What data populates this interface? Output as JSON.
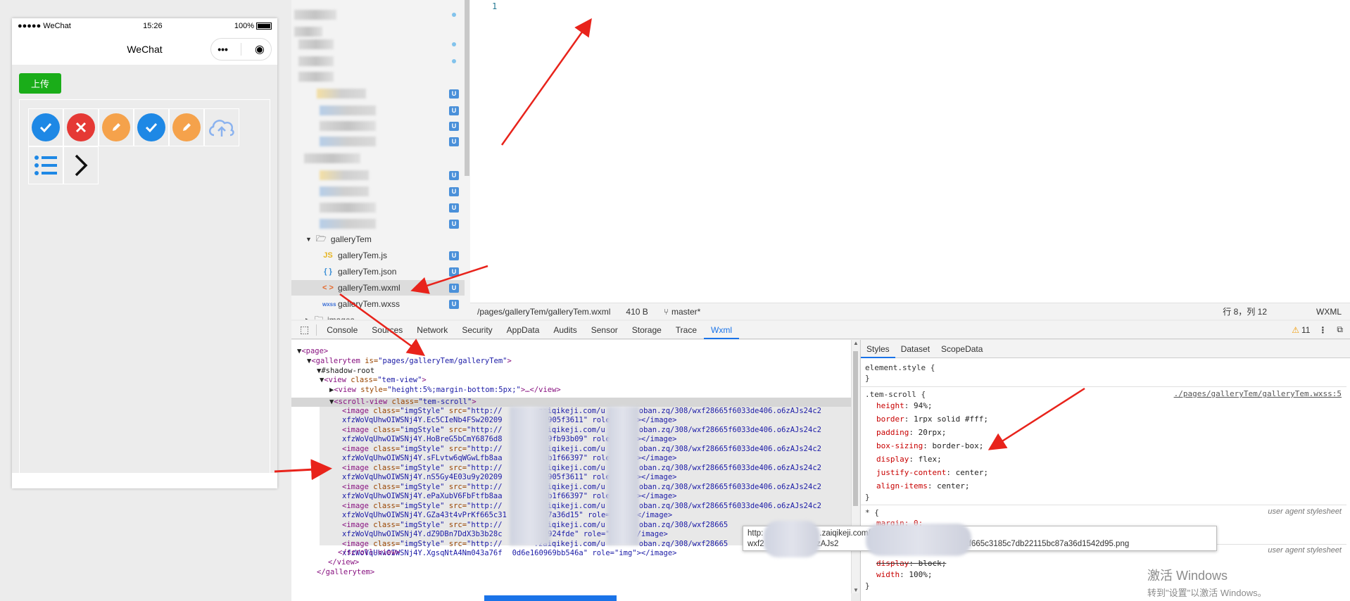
{
  "simulator": {
    "status": {
      "carrier": "●●●●● WeChat",
      "time": "15:26",
      "battery": "100%"
    },
    "nav_title": "WeChat",
    "capsule": {
      "more": "•••",
      "close": "◉"
    },
    "upload_label": "上传",
    "icons": [
      "check-circle-blue",
      "x-circle-red",
      "edit-circle-orange",
      "check-circle-blue",
      "edit-circle-orange",
      "cloud-upload-outline",
      "list-blue",
      "chevron-right-black"
    ],
    "colors": {
      "blue": "#1e88e5",
      "red": "#e53935",
      "orange": "#f5a24b",
      "green": "#1aad19"
    }
  },
  "file_tree": {
    "folder": "galleryTem",
    "files": [
      {
        "icon": "JS",
        "name": "galleryTem.js",
        "badge": "U"
      },
      {
        "icon": "{ }",
        "name": "galleryTem.json",
        "badge": "U"
      },
      {
        "icon": "< >",
        "name": "galleryTem.wxml",
        "badge": "U"
      },
      {
        "icon": "wxss",
        "name": "galleryTem.wxss",
        "badge": "U"
      }
    ],
    "next_folder": "images",
    "badge": "U"
  },
  "editor": {
    "line_number": "1",
    "status": {
      "path": "/pages/galleryTem/galleryTem.wxml",
      "size": "410 B",
      "branch": "master*",
      "position": "行 8，列 12",
      "lang": "WXML"
    }
  },
  "devtools": {
    "tabs": [
      "Console",
      "Sources",
      "Network",
      "Security",
      "AppData",
      "Audits",
      "Sensor",
      "Storage",
      "Trace",
      "Wxml"
    ],
    "active_tab": "Wxml",
    "warning_count": "11",
    "tree": {
      "page_open": "<page>",
      "gallerytem_open": "<gallerytem",
      "gallerytem_is_attr": "is=",
      "gallerytem_is_val": "\"pages/galleryTem/galleryTem\"",
      "shadow_root": "#shadow-root",
      "view_open": "<view",
      "view_class": "class=",
      "view_class_val": "\"tem-view\"",
      "inner_view": "<view",
      "inner_view_style": "style=",
      "inner_view_style_val": "\"height:5%;margin-bottom:5px;\"",
      "inner_view_rest": ">…</view>",
      "scroll_open": "<scroll-view",
      "scroll_class": "class=",
      "scroll_class_val": "\"tem-scroll\"",
      "images": [
        {
          "src_a": "\"http://",
          "src_b": ".zaiqikeji.com/u",
          "src_c": "oban.zq/308/wxf28665f6033de406.o6zAJs24c2",
          "cont": "xfzWoVqUhwOIWSNj4Y.Ec5CIeNb4FSw20209",
          "cont2": "c61be876905f3611",
          "tail": "\" role=\"img\"></image>"
        },
        {
          "src_a": "\"http://",
          "src_b": ".zaiqikeji.com/u",
          "src_c": "oban.zq/308/wxf28665f6033de406.o6zAJs24c2",
          "cont": "xfzWoVqUhwOIWSNj4Y.HoBreG5bCmY6876d8",
          "cont2": "73bafeb19fb93b09",
          "tail": "\" role=\"img\"></image>"
        },
        {
          "src_a": "\"http://",
          "src_b": ".zaiqikeji.com/u",
          "src_c": "oban.zq/308/wxf28665f6033de406.o6zAJs24c2",
          "cont": "xfzWoVqUhwOIWSNj4Y.sFLvtw6qWGwLfb8aa",
          "cont2": "9abe2885b1f66397",
          "tail": "\" role=\"img\"></image>"
        },
        {
          "src_a": "\"http://",
          "src_b": ".zaiqikeji.com/u",
          "src_c": "oban.zq/308/wxf28665f6033de406.o6zAJs24c2",
          "cont": "xfzWoVqUhwOIWSNj4Y.nS5Gy4E03u9y20209",
          "cont2": "c61be876905f3611",
          "tail": "\" role=\"img\"></image>"
        },
        {
          "src_a": "\"http://",
          "src_b": ".zaiqikeji.com/u",
          "src_c": "oban.zq/308/wxf28665f6033de406.o6zAJs24c2",
          "cont": "xfzWoVqUhwOIWSNj4Y.ePaXubV6FbFtfb8aa",
          "cont2": "9abe2885b1f66397",
          "tail": "\" role=\"img\"></image>"
        },
        {
          "src_a": "\"http://",
          "src_b": ".zaiqikeji.com/u",
          "src_c": "oban.zq/308/wxf28665f6033de406.o6zAJs24c2",
          "cont": "xfzWoVqUhwOIWSNj4Y.GZa43t4vPrKf665c31",
          "cont2": "2115bc87a36d15",
          "tail": "\" role=\"img\"></image>"
        },
        {
          "src_a": "\"http://",
          "src_b": ".zaiqikeji.com/u",
          "src_c": "oban.zq/308/wxf28665",
          "cont": "xfzWoVqUhwOIWSNj4Y.dZ9DBn7DdX3b3b28c",
          "cont2": "6b9e139f924fde",
          "tail": "\" role=\"img\"></image>"
        },
        {
          "src_a": "\"http://",
          "src_b": ".zaiqikeji.com/u",
          "src_c": "oban.zq/308/wxf28665",
          "cont": "xfzWoVqUhwOIWSNj4Y.XgsqNtA4Nm043a76f",
          "cont2": "0d6e160969bb546a",
          "tail": "\" role=\"img\"></image>"
        }
      ],
      "image_open": "<image",
      "image_class": "class=",
      "image_class_val": "\"imgStyle\"",
      "image_src": "src=",
      "scroll_close": "</scroll-view>",
      "view_close": "</view>",
      "gallerytem_close": "</gallerytem>"
    },
    "styles": {
      "tabs": [
        "Styles",
        "Dataset",
        "ScopeData"
      ],
      "element_style": "element.style {",
      "close_brace": "}",
      "rule_selector": ".tem-scroll {",
      "rule_source": "./pages/galleryTem/galleryTem.wxss:5",
      "props": [
        {
          "name": "height",
          "value": "94%;"
        },
        {
          "name": "border",
          "value": "1rpx solid #fff;"
        },
        {
          "name": "padding",
          "value": "20rpx;"
        },
        {
          "name": "box-sizing",
          "value": "border-box;"
        },
        {
          "name": "display",
          "value": "flex;"
        },
        {
          "name": "justify-content",
          "value": "center;"
        },
        {
          "name": "align-items",
          "value": "center;"
        }
      ],
      "ua_label": "user agent stylesheet",
      "star_selector": "* {",
      "star_prop": "margin: 0;",
      "ua_props": [
        {
          "name": "display",
          "value": "block;"
        },
        {
          "name": "width",
          "value": "100%;"
        }
      ]
    },
    "tooltip": {
      "line1_a": "http:",
      "line1_b": ".zaiqikeji.com/u",
      "line2_a": "wxf2",
      "line2_b": "3de406.o6zAJs2",
      "line2_c": "4Y.GZa43t4vPrKf665c3185c7db22115bc87a36d1542d95.png"
    }
  },
  "watermark": {
    "line1": "激活 Windows",
    "line2": "转到\"设置\"以激活 Windows。"
  }
}
